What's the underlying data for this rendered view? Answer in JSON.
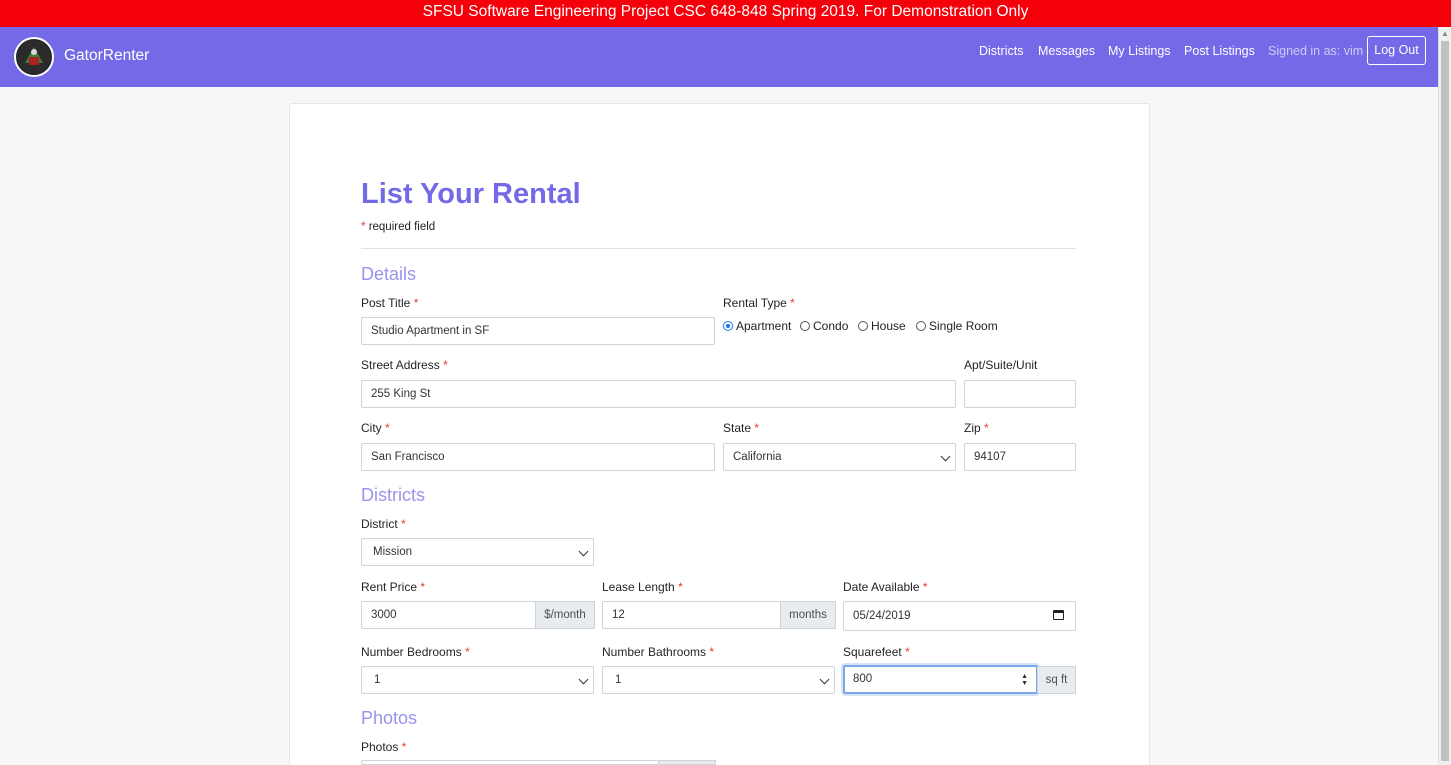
{
  "banner": "SFSU Software Engineering Project CSC 648-848 Spring 2019. For Demonstration Only",
  "nav": {
    "brand": "GatorRenter",
    "links": [
      "Districts",
      "Messages",
      "My Listings",
      "Post Listings"
    ],
    "signed_in": "Signed in as: vim",
    "logout": "Log Out"
  },
  "form": {
    "title": "List Your Rental",
    "required_star": "*",
    "required_note": "required field",
    "sections": {
      "details": "Details",
      "districts": "Districts",
      "photos": "Photos"
    },
    "post_title": {
      "label": "Post Title",
      "value": "Studio Apartment in SF"
    },
    "rental_type": {
      "label": "Rental Type",
      "options": [
        "Apartment",
        "Condo",
        "House",
        "Single Room"
      ],
      "selected": "Apartment"
    },
    "street": {
      "label": "Street Address",
      "value": "255 King St"
    },
    "apt": {
      "label": "Apt/Suite/Unit",
      "value": ""
    },
    "city": {
      "label": "City",
      "value": "San Francisco"
    },
    "state": {
      "label": "State",
      "value": "California"
    },
    "zip": {
      "label": "Zip",
      "value": "94107"
    },
    "district": {
      "label": "District",
      "value": "Mission"
    },
    "rent": {
      "label": "Rent Price",
      "value": "3000",
      "addon": "$/month"
    },
    "lease": {
      "label": "Lease Length",
      "value": "12",
      "addon": "months"
    },
    "date": {
      "label": "Date Available",
      "value": "05/24/2019"
    },
    "bedrooms": {
      "label": "Number Bedrooms",
      "value": "1"
    },
    "bathrooms": {
      "label": "Number Bathrooms",
      "value": "1"
    },
    "sqft": {
      "label": "Squarefeet",
      "value": "800",
      "addon": "sq ft"
    },
    "photos": {
      "label": "Photos"
    }
  },
  "colors": {
    "banner": "#f4000a",
    "navbar": "#7469e7",
    "accent": "#7469e7",
    "section": "#9a93ec",
    "required": "#e53935"
  }
}
